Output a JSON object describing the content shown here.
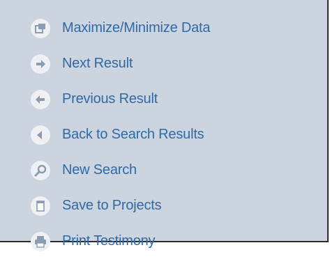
{
  "menu": {
    "items": [
      {
        "label": "Maximize/Minimize Data",
        "icon": "maximize-icon"
      },
      {
        "label": "Next Result",
        "icon": "arrow-right-icon"
      },
      {
        "label": "Previous Result",
        "icon": "arrow-left-icon"
      },
      {
        "label": "Back to Search Results",
        "icon": "back-triangle-icon"
      },
      {
        "label": "New Search",
        "icon": "magnifier-icon"
      },
      {
        "label": "Save to Projects",
        "icon": "save-page-icon"
      },
      {
        "label": "Print Testimony",
        "icon": "printer-icon"
      }
    ]
  },
  "colors": {
    "panel_bg": "#ccd4df",
    "link_text": "#2f6aa6",
    "icon_bg": "#eef0f3",
    "icon_glyph": "#8b9bb2"
  }
}
